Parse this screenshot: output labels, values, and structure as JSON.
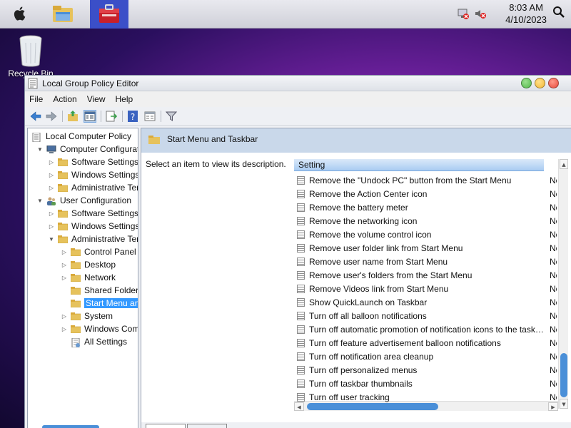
{
  "clock": {
    "time": "8:03 AM",
    "date": "4/10/2023"
  },
  "desktop": {
    "recycle_bin_label": "Recycle Bin"
  },
  "window": {
    "title": "Local Group Policy Editor",
    "menu": [
      "File",
      "Action",
      "View",
      "Help"
    ]
  },
  "tree": [
    {
      "label": "Local Computer Policy",
      "level": 0,
      "arrow": "",
      "icon": "policy"
    },
    {
      "label": "Computer Configuration",
      "level": 1,
      "arrow": "▼",
      "icon": "computer"
    },
    {
      "label": "Software Settings",
      "level": 2,
      "arrow": "▷",
      "icon": "folder"
    },
    {
      "label": "Windows Settings",
      "level": 2,
      "arrow": "▷",
      "icon": "folder"
    },
    {
      "label": "Administrative Templates",
      "level": 2,
      "arrow": "▷",
      "icon": "folder"
    },
    {
      "label": "User Configuration",
      "level": 1,
      "arrow": "▼",
      "icon": "user"
    },
    {
      "label": "Software Settings",
      "level": 2,
      "arrow": "▷",
      "icon": "folder"
    },
    {
      "label": "Windows Settings",
      "level": 2,
      "arrow": "▷",
      "icon": "folder"
    },
    {
      "label": "Administrative Templates",
      "level": 2,
      "arrow": "▼",
      "icon": "folder"
    },
    {
      "label": "Control Panel",
      "level": 3,
      "arrow": "▷",
      "icon": "folder"
    },
    {
      "label": "Desktop",
      "level": 3,
      "arrow": "▷",
      "icon": "folder"
    },
    {
      "label": "Network",
      "level": 3,
      "arrow": "▷",
      "icon": "folder"
    },
    {
      "label": "Shared Folders",
      "level": 3,
      "arrow": "",
      "icon": "folder"
    },
    {
      "label": "Start Menu and Taskbar",
      "level": 3,
      "arrow": "",
      "icon": "folder",
      "selected": true
    },
    {
      "label": "System",
      "level": 3,
      "arrow": "▷",
      "icon": "folder"
    },
    {
      "label": "Windows Components",
      "level": 3,
      "arrow": "▷",
      "icon": "folder"
    },
    {
      "label": "All Settings",
      "level": 3,
      "arrow": "",
      "icon": "settings"
    }
  ],
  "right": {
    "header": "Start Menu and Taskbar",
    "description": "Select an item to view its description.",
    "column_setting": "Setting",
    "rows": [
      {
        "name": "Remove the \"Undock PC\" button from the Start Menu",
        "state": "Not configured"
      },
      {
        "name": "Remove the Action Center icon",
        "state": "Not configured"
      },
      {
        "name": "Remove the battery meter",
        "state": "Not configured"
      },
      {
        "name": "Remove the networking icon",
        "state": "Not configured"
      },
      {
        "name": "Remove the volume control icon",
        "state": "Not configured"
      },
      {
        "name": "Remove user folder link from Start Menu",
        "state": "Not configured"
      },
      {
        "name": "Remove user name from Start Menu",
        "state": "Not configured"
      },
      {
        "name": "Remove user's folders from the Start Menu",
        "state": "Not configured"
      },
      {
        "name": "Remove Videos link from Start Menu",
        "state": "Not configured"
      },
      {
        "name": "Show QuickLaunch on Taskbar",
        "state": "Not configured"
      },
      {
        "name": "Turn off all balloon notifications",
        "state": "Not configured"
      },
      {
        "name": "Turn off automatic promotion of notification icons to the taskbar",
        "state": "Not configured"
      },
      {
        "name": "Turn off feature advertisement balloon notifications",
        "state": "Not configured"
      },
      {
        "name": "Turn off notification area cleanup",
        "state": "Not configured"
      },
      {
        "name": "Turn off personalized menus",
        "state": "Not configured"
      },
      {
        "name": "Turn off taskbar thumbnails",
        "state": "Not configured"
      },
      {
        "name": "Turn off user tracking",
        "state": "Not configured"
      }
    ]
  },
  "colors": {
    "accent": "#3399ff",
    "scroll_thumb": "#4a8fd8",
    "header_band": "#c9d8ea",
    "close": "#e8473a",
    "minimize": "#f5b833",
    "maximize": "#52b84a"
  }
}
